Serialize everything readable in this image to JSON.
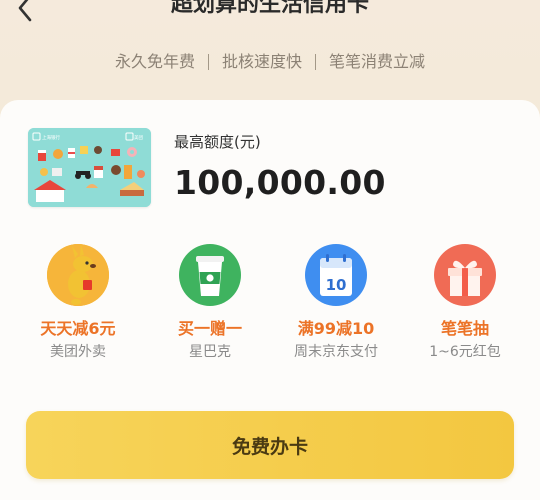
{
  "header": {
    "back_icon": "chevron-left-icon",
    "title": "超划算的生活信用卡"
  },
  "subtitle": {
    "items": [
      "永久免年费",
      "批核速度快",
      "笔笔消费立减"
    ]
  },
  "card": {
    "brand_left": "上海银行",
    "brand_right": "美团",
    "color": "#8fdcd6"
  },
  "limit": {
    "label": "最高额度(元)",
    "value": "100,000.00"
  },
  "benefits": [
    {
      "title": "天天减6元",
      "subtitle": "美团外卖",
      "icon": "kangaroo-icon"
    },
    {
      "title": "买一赠一",
      "subtitle": "星巴克",
      "icon": "coffee-cup-icon"
    },
    {
      "title": "满99减10",
      "subtitle": "周末京东支付",
      "icon": "calendar-coupon-icon",
      "icon_text": "10"
    },
    {
      "title": "笔笔抽",
      "subtitle": "1~6元红包",
      "icon": "gift-box-icon"
    }
  ],
  "apply_button": {
    "label": "免费办卡"
  },
  "colors": {
    "accent_orange": "#ec7327",
    "button_yellow": "#f5cd4c",
    "background": "#f5ead7"
  }
}
